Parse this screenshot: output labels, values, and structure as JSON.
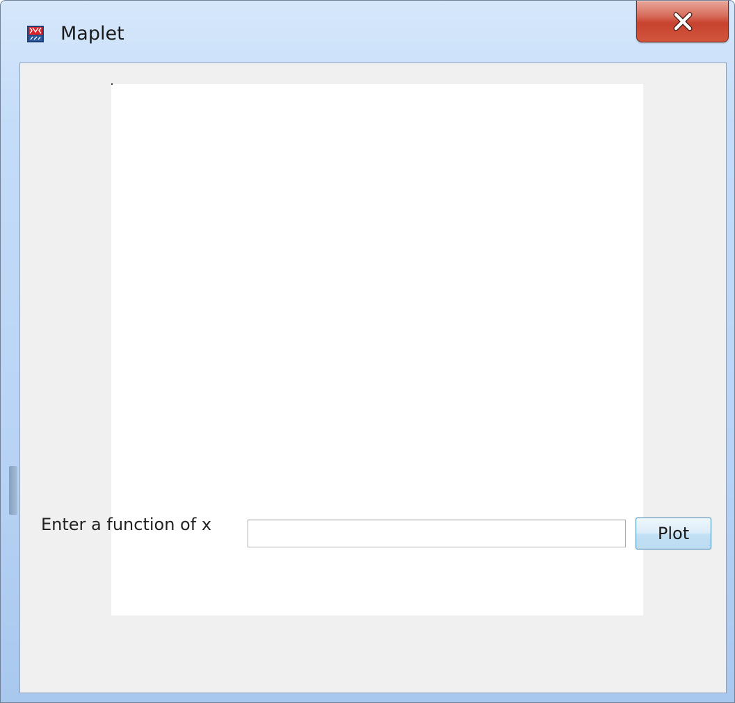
{
  "window": {
    "title": "Maplet",
    "icon": "maple-app-icon",
    "close_icon": "close-icon"
  },
  "plot": {
    "background": "#ffffff"
  },
  "controls": {
    "function_label": "Enter a function of x",
    "function_value": "",
    "function_placeholder": "",
    "plot_button_label": "Plot"
  },
  "colors": {
    "close_button": "#c7432f",
    "client_background": "#f0f0f0",
    "plot_button_border": "#3c7fb1"
  }
}
